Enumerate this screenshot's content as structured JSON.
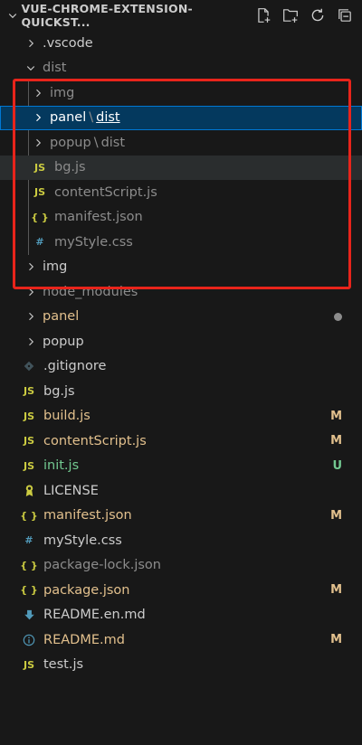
{
  "explorer": {
    "title": "VUE-CHROME-EXTENSION-QUICKST...",
    "toolbar": [
      "new-file-icon",
      "new-folder-icon",
      "refresh-icon",
      "collapse-all-icon"
    ]
  },
  "tree": [
    {
      "name": ".vscode",
      "kind": "folder",
      "expanded": false,
      "level": 0
    },
    {
      "name": "dist",
      "kind": "folder",
      "expanded": true,
      "level": 0,
      "children": [
        {
          "name": "img",
          "kind": "folder",
          "expanded": false
        },
        {
          "name": "panel",
          "compact": "dist",
          "kind": "folder",
          "expanded": false,
          "selected": true
        },
        {
          "name": "popup",
          "compact": "dist",
          "kind": "folder",
          "expanded": false
        },
        {
          "name": "bg.js",
          "kind": "js",
          "hover": true
        },
        {
          "name": "contentScript.js",
          "kind": "js"
        },
        {
          "name": "manifest.json",
          "kind": "json"
        },
        {
          "name": "myStyle.css",
          "kind": "css"
        }
      ]
    },
    {
      "name": "img",
      "kind": "folder",
      "expanded": false,
      "level": 0
    },
    {
      "name": "node_modules",
      "kind": "folder",
      "expanded": false,
      "level": 0,
      "status": "ignored"
    },
    {
      "name": "panel",
      "kind": "folder",
      "expanded": false,
      "level": 0,
      "status": "modified",
      "badge": "●"
    },
    {
      "name": "popup",
      "kind": "folder",
      "expanded": false,
      "level": 0
    },
    {
      "name": ".gitignore",
      "kind": "git",
      "level": 0
    },
    {
      "name": "bg.js",
      "kind": "js",
      "level": 0
    },
    {
      "name": "build.js",
      "kind": "js",
      "level": 0,
      "status": "modified",
      "badge": "M"
    },
    {
      "name": "contentScript.js",
      "kind": "js",
      "level": 0,
      "status": "modified",
      "badge": "M"
    },
    {
      "name": "init.js",
      "kind": "js",
      "level": 0,
      "status": "untracked",
      "badge": "U"
    },
    {
      "name": "LICENSE",
      "kind": "license",
      "level": 0
    },
    {
      "name": "manifest.json",
      "kind": "json",
      "level": 0,
      "status": "modified",
      "badge": "M"
    },
    {
      "name": "myStyle.css",
      "kind": "css",
      "level": 0
    },
    {
      "name": "package-lock.json",
      "kind": "json",
      "level": 0,
      "status": "ignored"
    },
    {
      "name": "package.json",
      "kind": "json",
      "level": 0,
      "status": "modified",
      "badge": "M"
    },
    {
      "name": "README.en.md",
      "kind": "md-download",
      "level": 0
    },
    {
      "name": "README.md",
      "kind": "md-info",
      "level": 0,
      "status": "modified",
      "badge": "M"
    },
    {
      "name": "test.js",
      "kind": "js",
      "level": 0
    }
  ],
  "icon_glyphs": {
    "js": "JS",
    "json": "{ }",
    "css": "#"
  },
  "colors": {
    "highlight_box": "#e8241b",
    "selection": "#04395e",
    "modified": "#e2c08d",
    "untracked": "#73c991",
    "js_icon": "#cbcb41",
    "css_icon": "#519aba"
  }
}
